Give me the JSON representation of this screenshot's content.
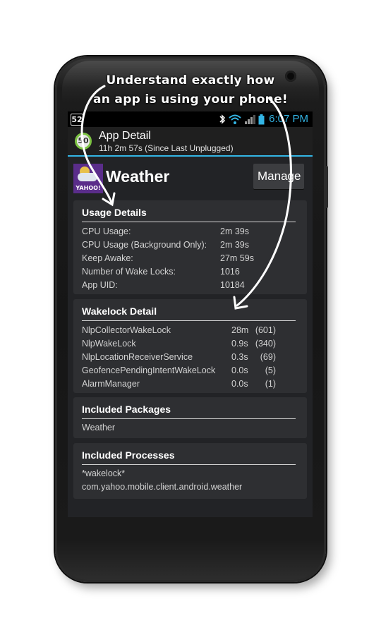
{
  "caption": {
    "line1": "Understand exactly how",
    "line2": "an app is using your phone!"
  },
  "statusbar": {
    "left_badge": "52",
    "time": "6:07 PM",
    "icons": [
      "bluetooth-icon",
      "wifi-icon",
      "signal-icon",
      "battery-icon"
    ]
  },
  "titlebar": {
    "battery_level": "50",
    "title": "App Detail",
    "subtitle": "11h 2m 57s (Since Last Unplugged)"
  },
  "app": {
    "icon_brand": "YAHOO!",
    "name": "Weather",
    "manage_label": "Manage"
  },
  "usage": {
    "title": "Usage Details",
    "rows": [
      {
        "label": "CPU Usage:",
        "value": "2m 39s"
      },
      {
        "label": "CPU Usage (Background Only):",
        "value": "2m 39s"
      },
      {
        "label": "Keep Awake:",
        "value": "27m 59s"
      },
      {
        "label": "Number of Wake Locks:",
        "value": "1016"
      },
      {
        "label": "App UID:",
        "value": "10184"
      }
    ]
  },
  "wakelock": {
    "title": "Wakelock Detail",
    "rows": [
      {
        "label": "NlpCollectorWakeLock",
        "value": "28m",
        "count": "(601)"
      },
      {
        "label": "NlpWakeLock",
        "value": "0.9s",
        "count": "(340)"
      },
      {
        "label": "NlpLocationReceiverService",
        "value": "0.3s",
        "count": "(69)"
      },
      {
        "label": "GeofencePendingIntentWakeLock",
        "value": "0.0s",
        "count": "(5)"
      },
      {
        "label": "AlarmManager",
        "value": "0.0s",
        "count": "(1)"
      }
    ]
  },
  "packages": {
    "title": "Included Packages",
    "items": [
      "Weather"
    ]
  },
  "processes": {
    "title": "Included Processes",
    "items": [
      "*wakelock*",
      "com.yahoo.mobile.client.android.weather"
    ]
  },
  "colors": {
    "accent": "#33b5e5",
    "card_bg": "#2e2f32",
    "content_bg": "#222326",
    "battery_ring": "#7cc242",
    "app_icon_bg": "#5a2d8a"
  }
}
